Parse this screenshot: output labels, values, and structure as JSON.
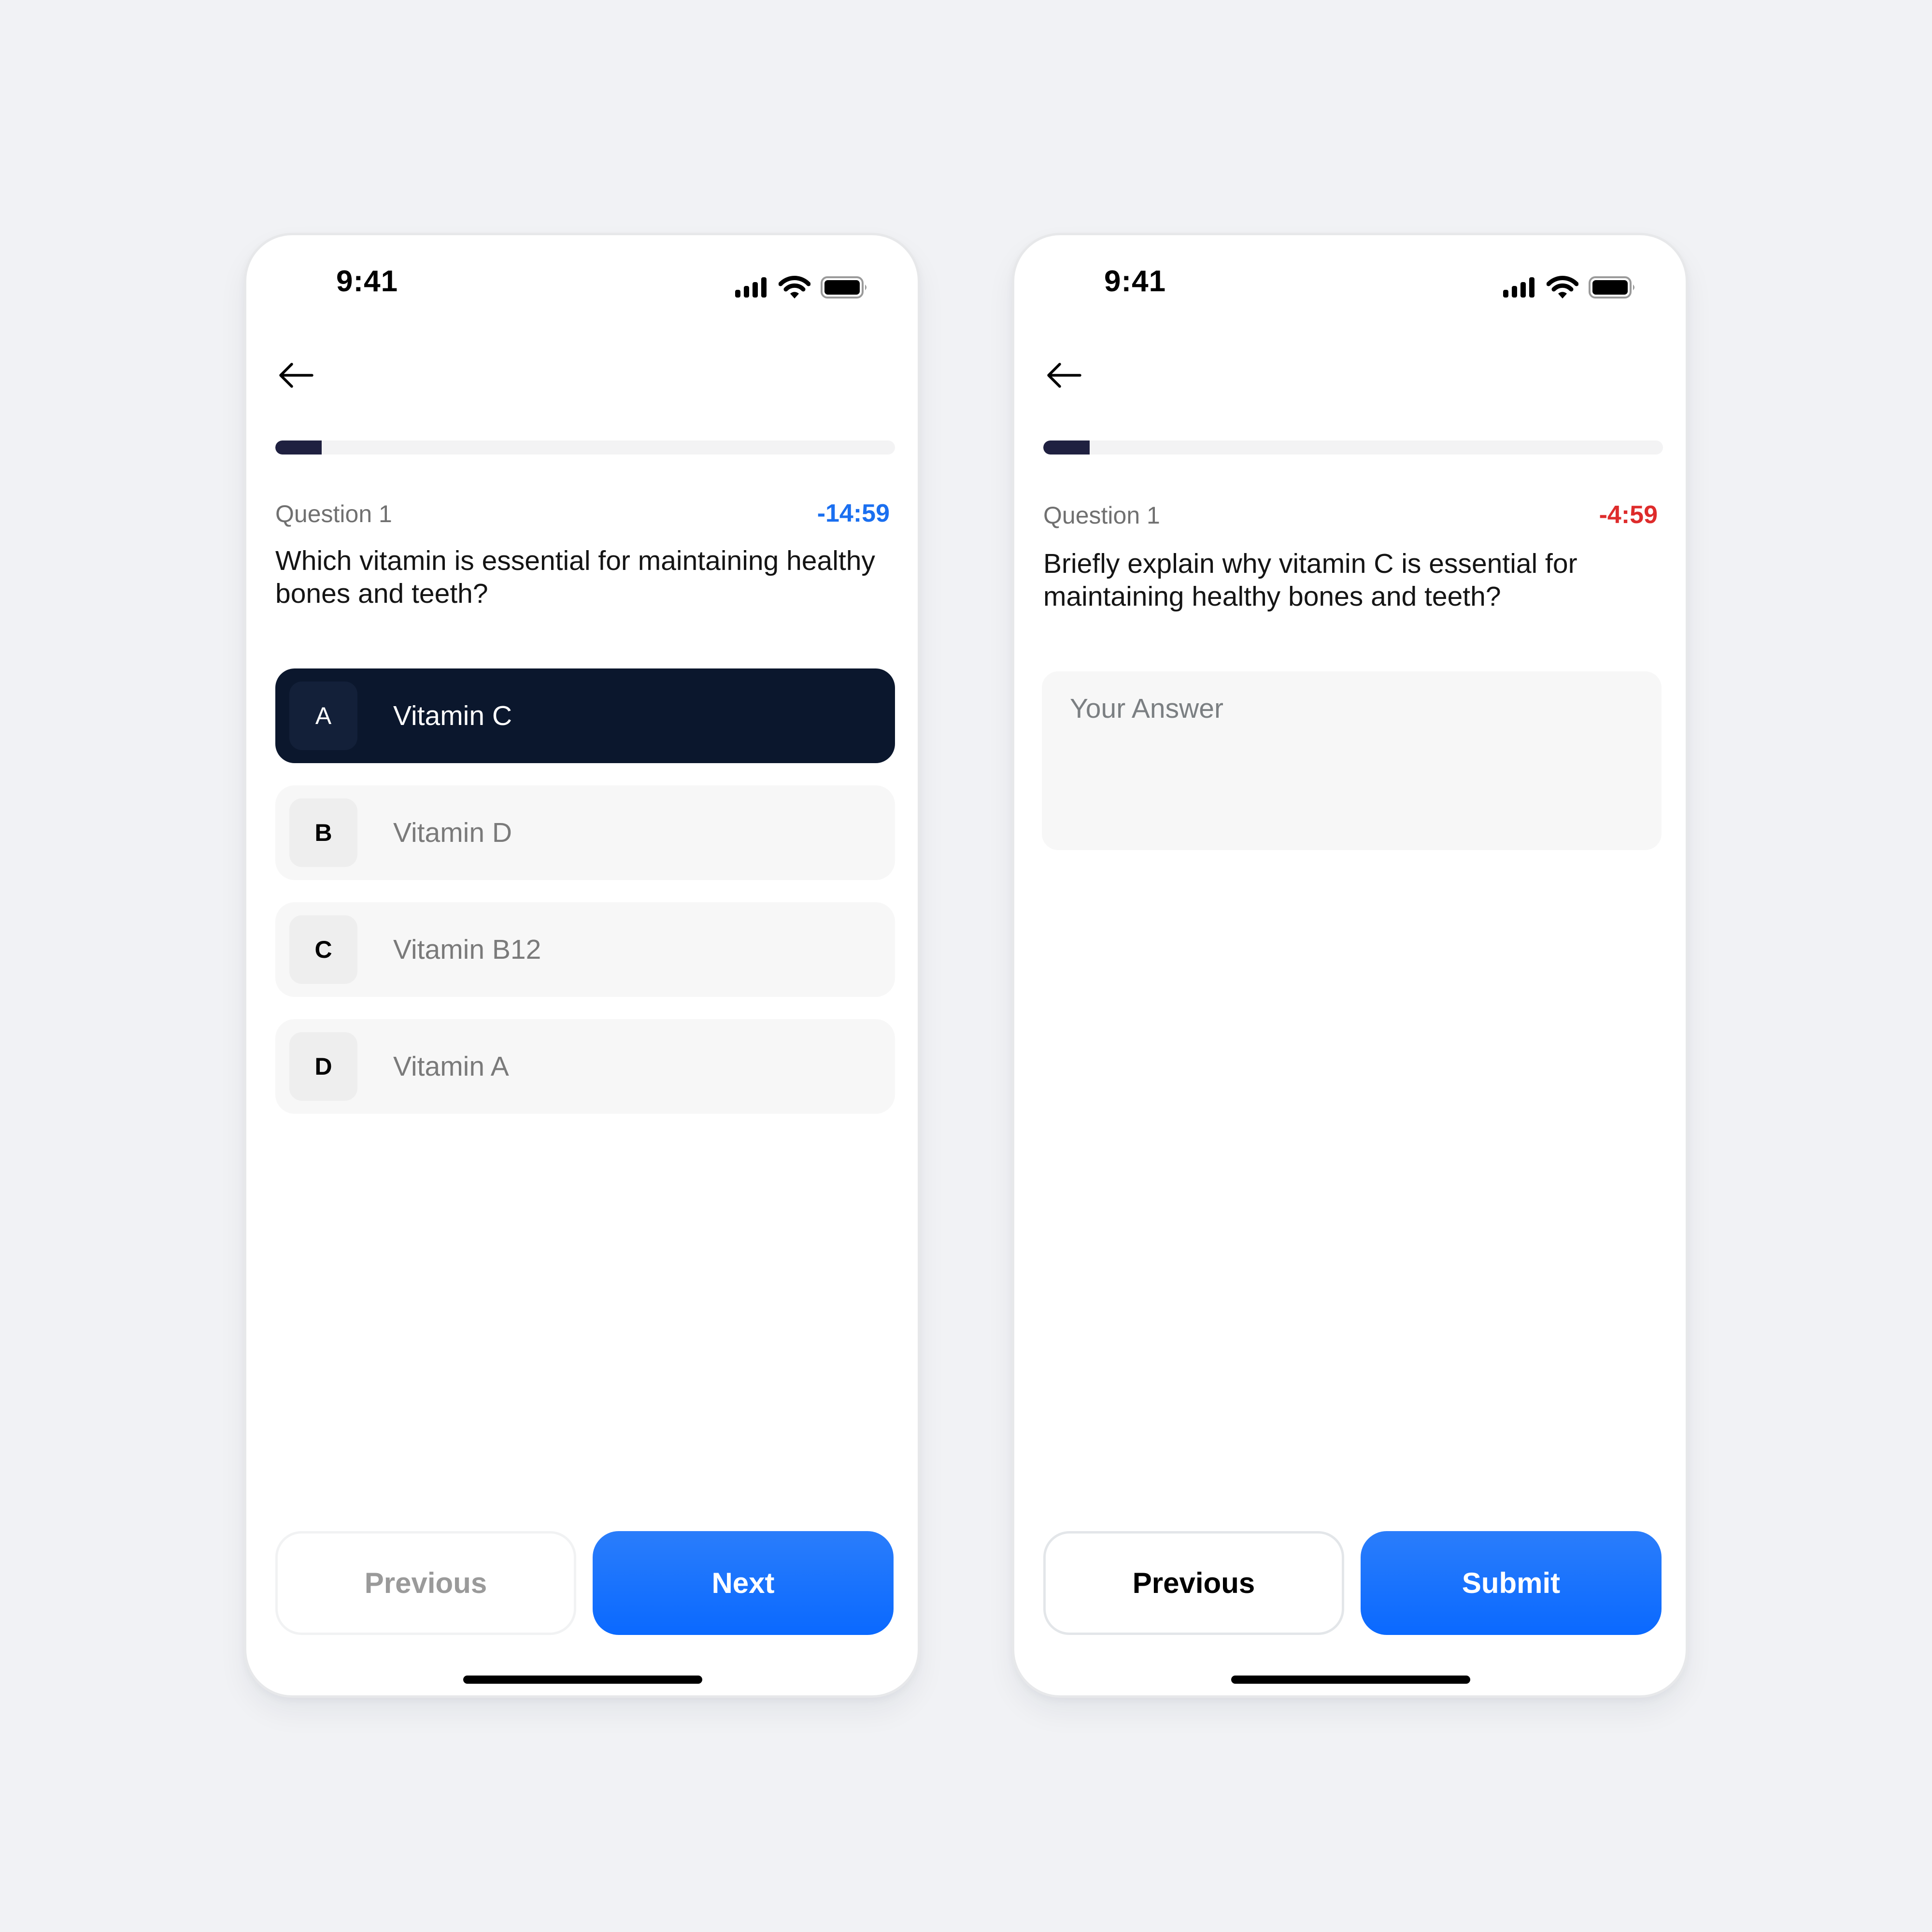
{
  "screens": [
    {
      "status_bar": {
        "time": "9:41",
        "icons": [
          "signal-icon",
          "wifi-icon",
          "battery-icon"
        ]
      },
      "back_icon": "arrow-left-icon",
      "progress": {
        "fraction": 0.075
      },
      "question_label": "Question 1",
      "timer": {
        "text": "-14:59",
        "color": "#1a6ff0"
      },
      "question_text": "Which vitamin is essential for maintaining healthy bones and teeth?",
      "options": [
        {
          "letter": "A",
          "label": "Vitamin C",
          "selected": true
        },
        {
          "letter": "B",
          "label": "Vitamin D",
          "selected": false
        },
        {
          "letter": "C",
          "label": "Vitamin B12",
          "selected": false
        },
        {
          "letter": "D",
          "label": "Vitamin A",
          "selected": false
        }
      ],
      "buttons": {
        "previous": "Previous",
        "primary": "Next",
        "previous_enabled": false
      }
    },
    {
      "status_bar": {
        "time": "9:41",
        "icons": [
          "signal-icon",
          "wifi-icon",
          "battery-icon"
        ]
      },
      "back_icon": "arrow-left-icon",
      "progress": {
        "fraction": 0.075
      },
      "question_label": "Question 1",
      "timer": {
        "text": "-4:59",
        "color": "#de2b2b"
      },
      "question_text": "Briefly explain why vitamin C is essential for maintaining healthy bones and teeth?",
      "answer": {
        "value": "",
        "placeholder": "Your Answer"
      },
      "buttons": {
        "previous": "Previous",
        "primary": "Submit",
        "previous_enabled": true
      }
    }
  ],
  "colors": {
    "background": "#f1f2f5",
    "accent": "#0a69ff",
    "selected_option": "#0b172d",
    "progress_fill": "#1f2040"
  }
}
